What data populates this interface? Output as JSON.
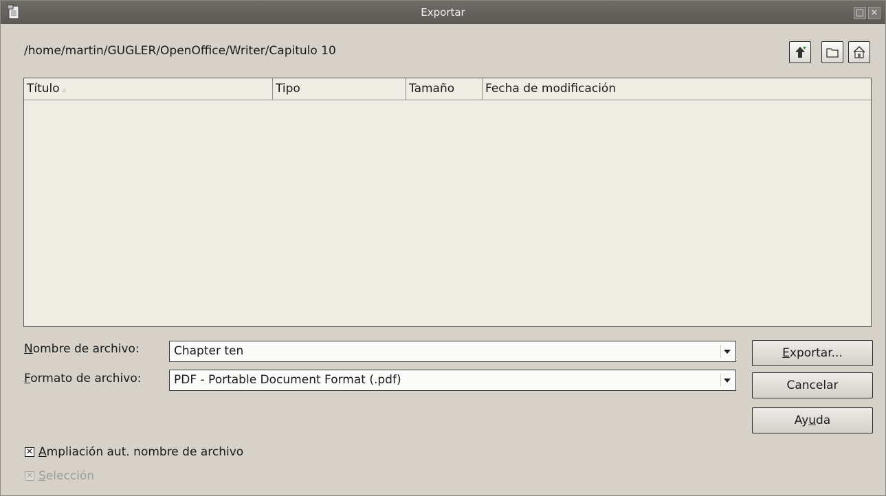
{
  "window": {
    "title": "Exportar"
  },
  "toolbar": {
    "path": "/home/martin/GUGLER/OpenOffice/Writer/Capitulo 10",
    "icons": [
      "up-level-icon",
      "new-folder-icon",
      "home-icon"
    ]
  },
  "file_list": {
    "columns": [
      "Título",
      "Tipo",
      "Tamaño",
      "Fecha de modificación"
    ],
    "sort_indicator": "▵",
    "rows": []
  },
  "form": {
    "filename_label_u": "N",
    "filename_label_rest": "ombre de archivo:",
    "filename_value": "Chapter ten",
    "format_label_u": "F",
    "format_label_rest": "ormato de archivo:",
    "format_value": "PDF - Portable Document Format (.pdf)"
  },
  "buttons": {
    "export_u": "E",
    "export_rest": "xportar...",
    "cancel": "Cancelar",
    "help_pre": "Ay",
    "help_u": "u",
    "help_post": "da"
  },
  "options": {
    "auto_ext_u": "A",
    "auto_ext_rest": "mpliación aut. nombre de archivo",
    "auto_ext_checked": true,
    "selection_u": "S",
    "selection_rest": "elección",
    "selection_checked": true,
    "selection_enabled": false
  }
}
